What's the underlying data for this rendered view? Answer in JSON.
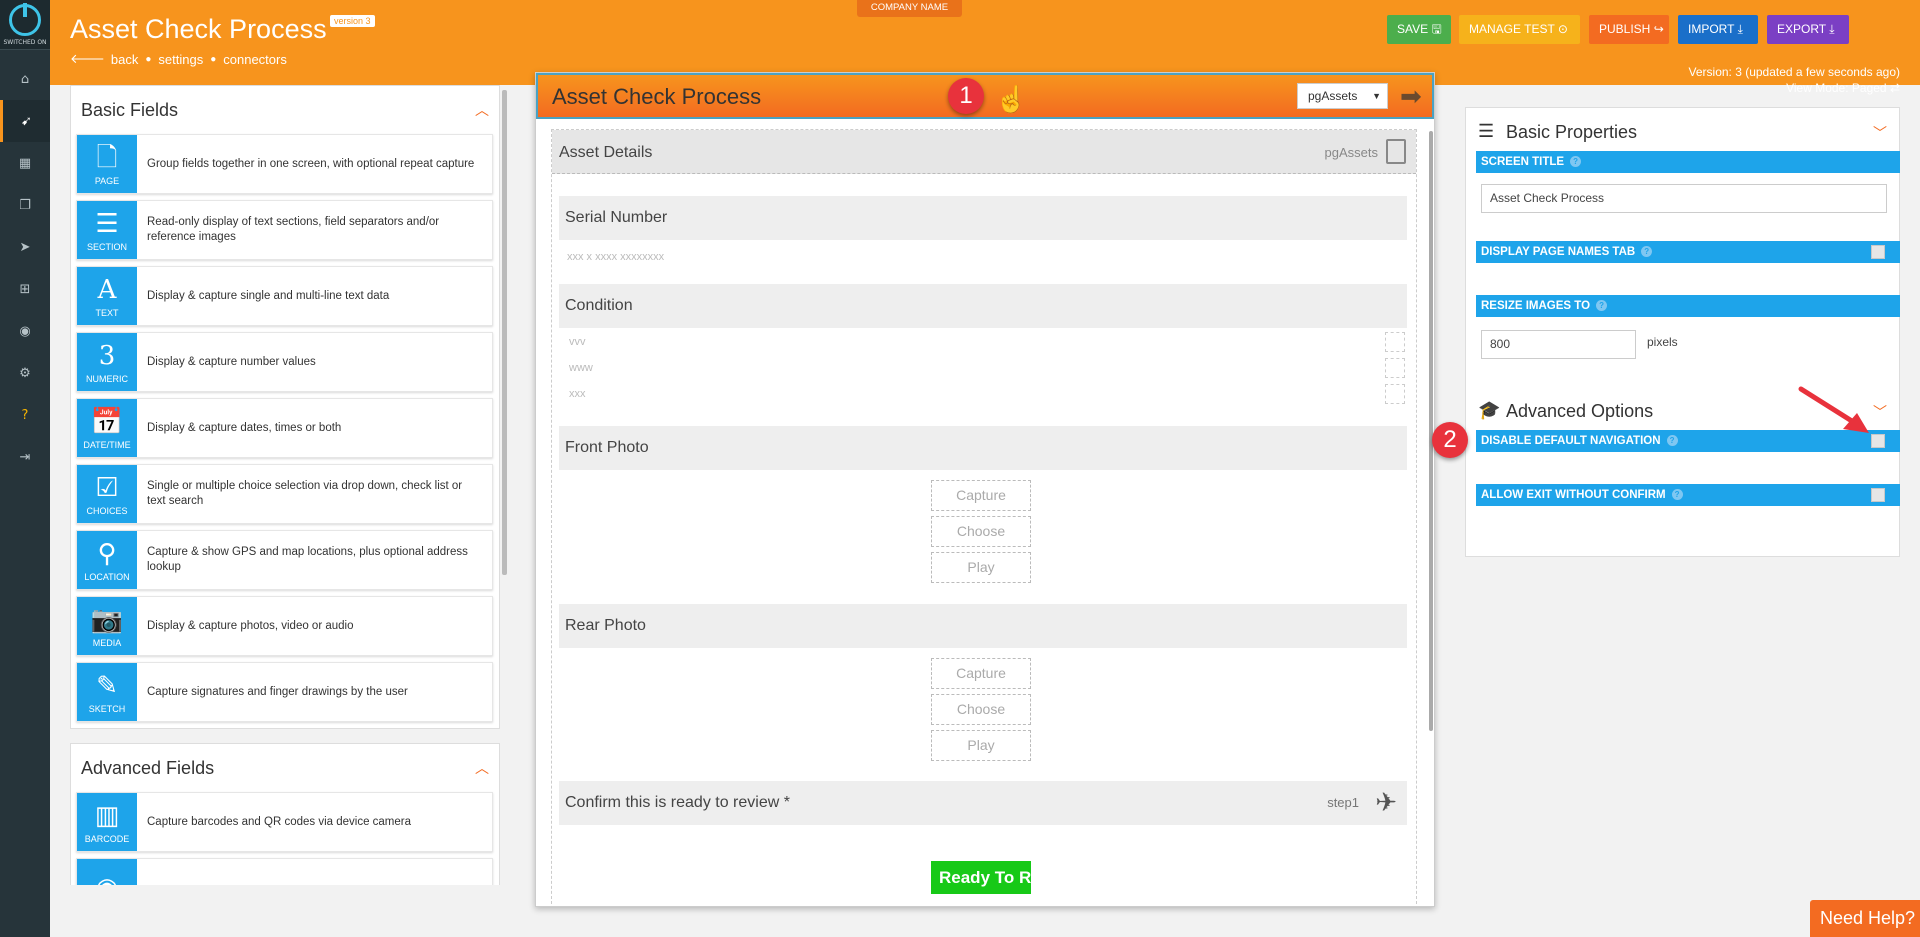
{
  "app": {
    "title": "Asset Check Process",
    "version_badge": "version 3",
    "company_name": "COMPANY NAME",
    "breadcrumbs": [
      "back",
      "settings",
      "connectors"
    ],
    "version_info": "Version: 3 (updated a few seconds ago)",
    "view_mode": "View Mode: Paged"
  },
  "toolbar": {
    "save": "SAVE",
    "manage_test": "MANAGE TEST",
    "publish": "PUBLISH",
    "import": "IMPORT",
    "export": "EXPORT"
  },
  "rail": {
    "logo_caption": "SWITCHED ON",
    "items": [
      "home-icon",
      "rocket-icon",
      "table-icon",
      "copy-icon",
      "send-icon",
      "sitemap-icon",
      "globe-icon",
      "cogs-icon",
      "help-icon",
      "sign-out-icon"
    ]
  },
  "basic_fields": {
    "title": "Basic Fields",
    "items": [
      {
        "name": "PAGE",
        "glyph": "🗋",
        "desc": "Group fields together in one screen, with optional repeat capture"
      },
      {
        "name": "SECTION",
        "glyph": "☰",
        "desc": "Read-only display of text sections, field separators and/or reference images"
      },
      {
        "name": "TEXT",
        "glyph": "A",
        "desc": "Display & capture single and multi-line text data"
      },
      {
        "name": "NUMERIC",
        "glyph": "3",
        "desc": "Display & capture number values"
      },
      {
        "name": "DATE/TIME",
        "glyph": "📅",
        "desc": "Display & capture dates, times or both"
      },
      {
        "name": "CHOICES",
        "glyph": "☑",
        "desc": "Single or multiple choice selection via drop down, check list or text search"
      },
      {
        "name": "LOCATION",
        "glyph": "⚲",
        "desc": "Capture & show GPS and map locations, plus optional address lookup"
      },
      {
        "name": "MEDIA",
        "glyph": "📷",
        "desc": "Display & capture photos, video or audio"
      },
      {
        "name": "SKETCH",
        "glyph": "✎",
        "desc": "Capture signatures and finger drawings by the user"
      }
    ]
  },
  "advanced_fields": {
    "title": "Advanced Fields",
    "items": [
      {
        "name": "BARCODE",
        "glyph": "▥",
        "desc": "Capture barcodes and QR codes via device camera"
      }
    ]
  },
  "canvas": {
    "title": "Asset Check Process",
    "page_select": "pgAssets",
    "page": {
      "title": "Asset Details",
      "name": "pgAssets"
    },
    "fields": {
      "serial_label": "Serial Number",
      "serial_placeholder": "xxx x xxxx xxxxxxxx",
      "condition_label": "Condition",
      "condition_options": [
        "vvv",
        "www",
        "xxx"
      ],
      "front_label": "Front Photo",
      "rear_label": "Rear Photo",
      "capture": "Capture",
      "choose": "Choose",
      "play": "Play",
      "confirm_label": "Confirm this is ready to review *",
      "confirm_step": "step1",
      "ready_button": "Ready To R"
    }
  },
  "properties": {
    "basic_title": "Basic Properties",
    "screen_title_label": "SCREEN TITLE",
    "screen_title_value": "Asset Check Process",
    "display_page_names_label": "DISPLAY PAGE NAMES TAB",
    "resize_images_label": "RESIZE IMAGES TO",
    "resize_images_value": "800",
    "pixels_label": "pixels",
    "advanced_title": "Advanced Options",
    "disable_nav_label": "DISABLE DEFAULT NAVIGATION",
    "allow_exit_label": "ALLOW EXIT WITHOUT CONFIRM"
  },
  "markers": {
    "one": "1",
    "two": "2"
  },
  "need_help": "Need Help?"
}
